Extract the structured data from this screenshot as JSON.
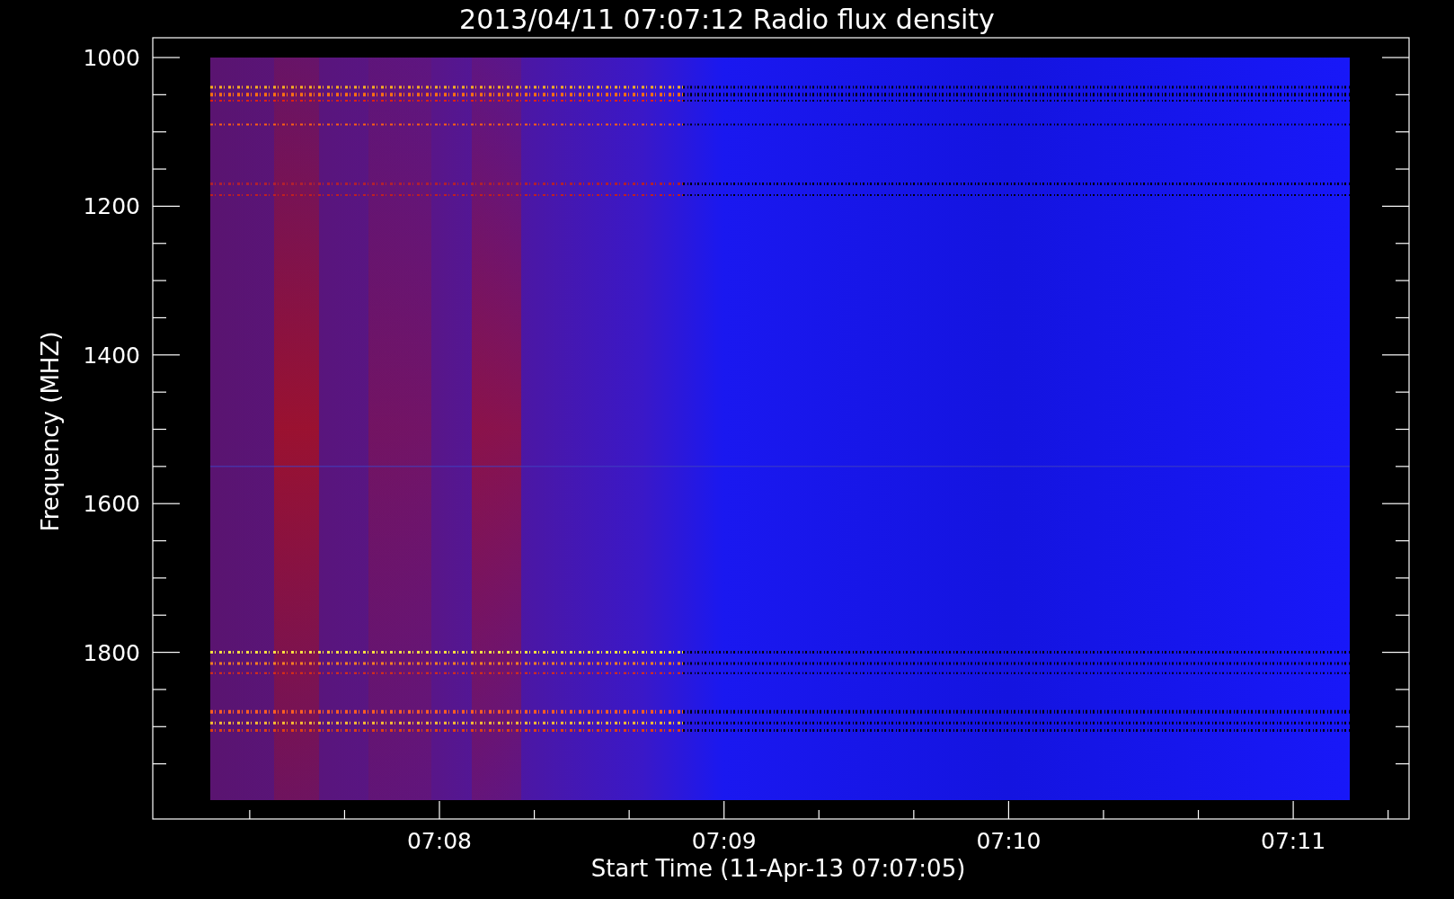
{
  "title": "2013/04/11 07:07:12 Radio flux density",
  "ylabel": "Frequency (MHZ)",
  "xlabel": "Start Time (11-Apr-13 07:07:05)",
  "yticks": [
    "1000",
    "1200",
    "1400",
    "1600",
    "1800"
  ],
  "xticks": [
    "07:08",
    "07:09",
    "07:10",
    "07:11"
  ]
}
